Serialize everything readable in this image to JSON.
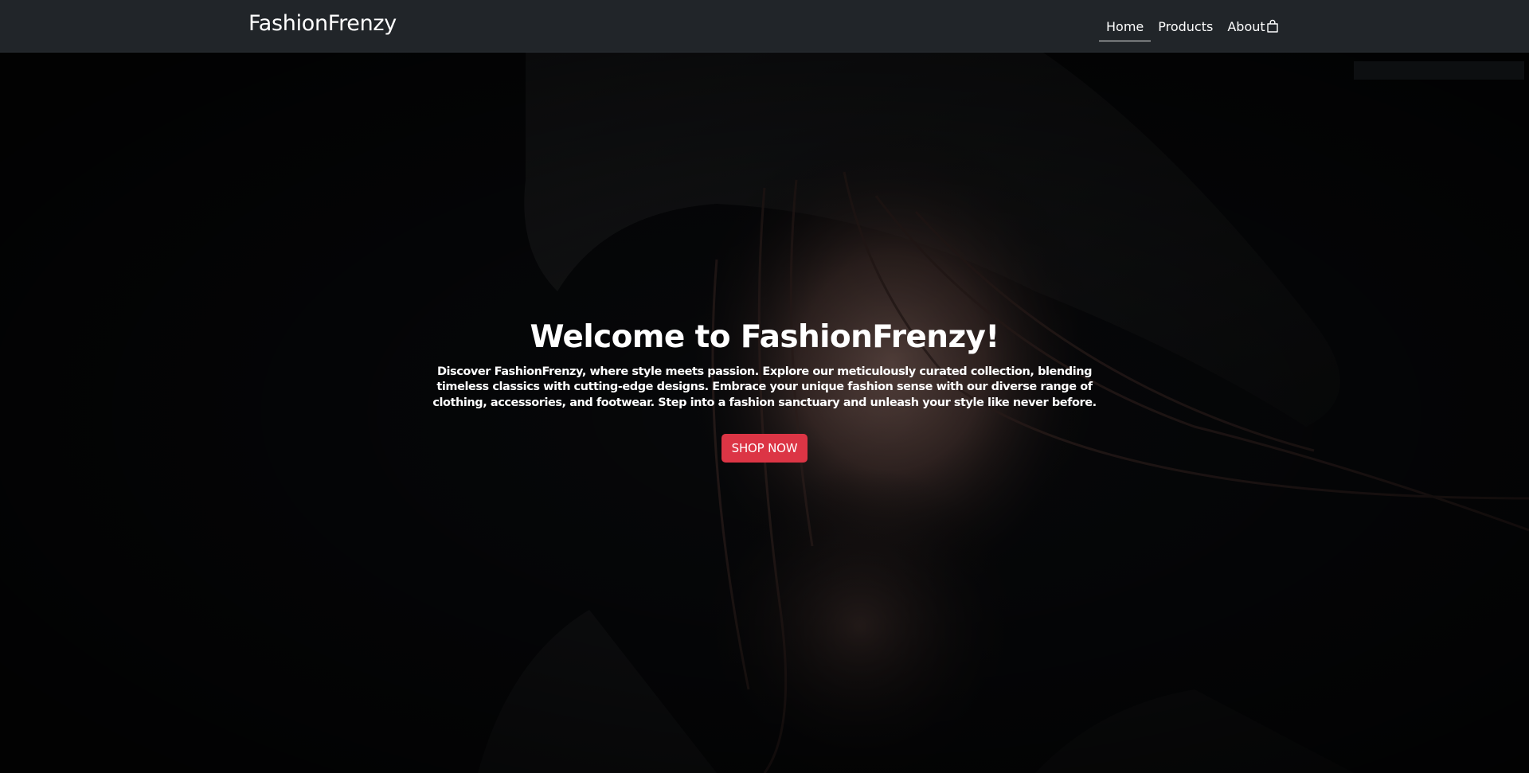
{
  "navbar": {
    "brand": "FashionFrenzy",
    "links": [
      {
        "label": "Home",
        "active": true
      },
      {
        "label": "Products",
        "active": false
      },
      {
        "label": "About",
        "active": false
      }
    ],
    "cart_icon": "shopping-bag-icon"
  },
  "hero": {
    "title": "Welcome to FashionFrenzy!",
    "description": "Discover FashionFrenzy, where style meets passion. Explore our meticulously curated collection, blending timeless classics with cutting-edge designs. Embrace your unique fashion sense with our diverse range of clothing, accessories, and footwear. Step into a fashion sanctuary and unleash your style like never before.",
    "cta_label": "SHOP NOW"
  },
  "colors": {
    "navbar_bg": "#212529",
    "cta_bg": "#dc3545",
    "text": "#ffffff",
    "hero_bg": "#050607"
  }
}
